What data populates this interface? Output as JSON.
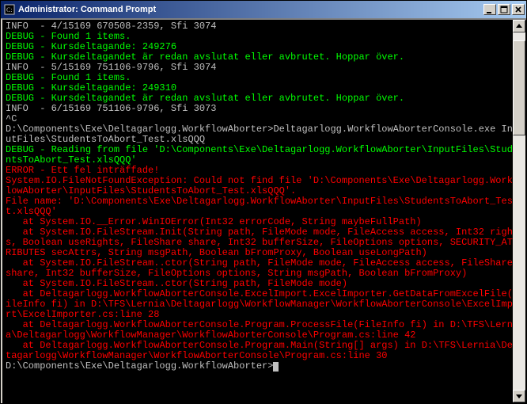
{
  "title": "Administrator: Command Prompt",
  "lines": [
    {
      "cls": "c-silver",
      "text": "INFO  - 4/15169 670508-2359, Sfi 3074"
    },
    {
      "cls": "c-green",
      "text": "DEBUG - Found 1 items."
    },
    {
      "cls": "c-green",
      "text": "DEBUG - Kursdeltagande: 249276"
    },
    {
      "cls": "c-green",
      "text": "DEBUG - Kursdeltagandet är redan avslutat eller avbrutet. Hoppar över."
    },
    {
      "cls": "c-silver",
      "text": "INFO  - 5/15169 751106-9796, Sfi 3074"
    },
    {
      "cls": "c-green",
      "text": "DEBUG - Found 1 items."
    },
    {
      "cls": "c-green",
      "text": "DEBUG - Kursdeltagande: 249310"
    },
    {
      "cls": "c-green",
      "text": "DEBUG - Kursdeltagandet är redan avslutat eller avbrutet. Hoppar över."
    },
    {
      "cls": "c-silver",
      "text": "INFO  - 6/15169 751106-9796, Sfi 3073"
    },
    {
      "cls": "c-silver",
      "text": "^C"
    },
    {
      "cls": "c-silver",
      "text": "D:\\Components\\Exe\\Deltagarlogg.WorkflowAborter>Deltagarlogg.WorkflowAborterConsole.exe InputFiles\\StudentsToAbort_Test.xlsQQQ"
    },
    {
      "cls": "c-green",
      "text": "DEBUG - Reading from file 'D:\\Components\\Exe\\Deltagarlogg.WorkflowAborter\\InputFiles\\StudentsToAbort_Test.xlsQQQ'"
    },
    {
      "cls": "c-red",
      "text": "ERROR - Ett fel inträffade!"
    },
    {
      "cls": "c-red",
      "text": "System.IO.FileNotFoundException: Could not find file 'D:\\Components\\Exe\\Deltagarlogg.WorkflowAborter\\InputFiles\\StudentsToAbort_Test.xlsQQQ'."
    },
    {
      "cls": "c-red",
      "text": "File name: 'D:\\Components\\Exe\\Deltagarlogg.WorkflowAborter\\InputFiles\\StudentsToAbort_Test.xlsQQQ'"
    },
    {
      "cls": "c-red",
      "text": "   at System.IO.__Error.WinIOError(Int32 errorCode, String maybeFullPath)"
    },
    {
      "cls": "c-red",
      "text": "   at System.IO.FileStream.Init(String path, FileMode mode, FileAccess access, Int32 rights, Boolean useRights, FileShare share, Int32 bufferSize, FileOptions options, SECURITY_ATTRIBUTES secAttrs, String msgPath, Boolean bFromProxy, Boolean useLongPath)"
    },
    {
      "cls": "c-red",
      "text": "   at System.IO.FileStream..ctor(String path, FileMode mode, FileAccess access, FileShare share, Int32 bufferSize, FileOptions options, String msgPath, Boolean bFromProxy)"
    },
    {
      "cls": "c-red",
      "text": "   at System.IO.FileStream..ctor(String path, FileMode mode)"
    },
    {
      "cls": "c-red",
      "text": "   at Deltagarlogg.WorkflowAborterConsole.ExcelImport.ExcelImporter.GetDataFromExcelFile(FileInfo fi) in D:\\TFS\\Lernia\\Deltagarlogg\\WorkflowManager\\WorkflowAborterConsole\\ExcelImport\\ExcelImporter.cs:line 28"
    },
    {
      "cls": "c-red",
      "text": "   at Deltagarlogg.WorkflowAborterConsole.Program.ProcessFile(FileInfo fi) in D:\\TFS\\Lernia\\Deltagarlogg\\WorkflowManager\\WorkflowAborterConsole\\Program.cs:line 42"
    },
    {
      "cls": "c-red",
      "text": "   at Deltagarlogg.WorkflowAborterConsole.Program.Main(String[] args) in D:\\TFS\\Lernia\\Deltagarlogg\\WorkflowManager\\WorkflowAborterConsole\\Program.cs:line 30"
    },
    {
      "cls": "c-silver",
      "text": ""
    }
  ],
  "prompt": "D:\\Components\\Exe\\Deltagarlogg.WorkflowAborter>"
}
